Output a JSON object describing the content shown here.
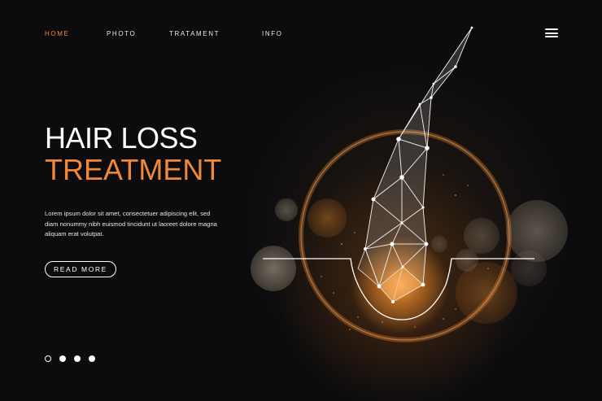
{
  "nav": {
    "items": [
      {
        "label": "HOME",
        "active": true
      },
      {
        "label": "PHOTO",
        "active": false
      },
      {
        "label": "TRATAMENT",
        "active": false
      },
      {
        "label": "INFO",
        "active": false
      }
    ],
    "menu_icon": "hamburger-menu-icon"
  },
  "hero": {
    "title_line1": "HAIR LOSS",
    "title_line2": "TREATMENT",
    "body": "Lorem ipsum dolor sit amet, consectetuer adipiscing elit, sed diam nonummy nibh euismod tincidunt ut laoreet dolore magna aliquam erat volutpat.",
    "button_label": "READ MORE"
  },
  "slider": {
    "total": 4,
    "active_index": 0
  },
  "colors": {
    "background": "#0c0c0e",
    "accent": "#f0883a",
    "text": "#ffffff"
  }
}
